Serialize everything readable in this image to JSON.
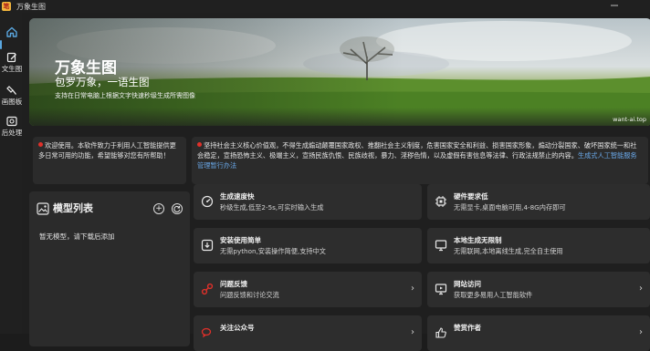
{
  "window": {
    "title": "万象生图",
    "app_icon_glyph": "笔"
  },
  "sidebar": {
    "items": [
      {
        "label": "",
        "icon": "home-icon"
      },
      {
        "label": "文生图",
        "icon": "pen-square-icon"
      },
      {
        "label": "画图板",
        "icon": "paint-tool-icon"
      },
      {
        "label": "后处理",
        "icon": "image-edit-icon"
      }
    ]
  },
  "banner": {
    "title": "万象生图",
    "subtitle": "包罗万象，一语生图",
    "description": "支持在日常电脑上根据文字快速秒级生成所需图像",
    "credit": "want-ai.top"
  },
  "notices": {
    "welcome": "欢迎使用。本软件致力于利用人工智能提供更多日常可用的功能，希望能够对您有所帮助！",
    "policy": "坚持社会主义核心价值观，不得生成煽动颠覆国家政权、推翻社会主义制度，危害国家安全和利益、损害国家形象，煽动分裂国家、破坏国家统一和社会稳定，宣扬恐怖主义、极端主义，宣扬民族仇恨、民族歧视，暴力、淫秽色情，以及虚假有害信息等法律、行政法规禁止的内容。",
    "policy_link": "生成式人工智能服务管理暂行办法"
  },
  "models": {
    "title": "模型列表",
    "empty_text": "暂无模型，请下载后添加"
  },
  "features": [
    {
      "title": "生成速度快",
      "desc": "秒级生成,低至2-5s,可实时输入生成",
      "icon": "speed-icon",
      "chevron": false
    },
    {
      "title": "硬件要求低",
      "desc": "无需显卡,桌面电脑可用,4-8G内存即可",
      "icon": "chip-icon",
      "chevron": false
    },
    {
      "title": "安装使用简单",
      "desc": "无需python,安装操作简便,支持中文",
      "icon": "install-icon",
      "chevron": false
    },
    {
      "title": "本地生成无限制",
      "desc": "无需联网,本地离线生成,完全自主使用",
      "icon": "offline-icon",
      "chevron": false
    },
    {
      "title": "问题反馈",
      "desc": "问题反馈和讨论交流",
      "icon": "feedback-icon",
      "chevron": true
    },
    {
      "title": "网站访问",
      "desc": "获取更多易用人工智能软件",
      "icon": "website-icon",
      "chevron": true
    },
    {
      "title": "关注公众号",
      "desc": "",
      "icon": "wechat-icon",
      "chevron": true
    },
    {
      "title": "赞赏作者",
      "desc": "",
      "icon": "like-icon",
      "chevron": true
    }
  ],
  "colors": {
    "accent": "#5aa7e0",
    "alert_red": "#e0302a",
    "link": "#6aa9ea",
    "card_bg": "#2d2d2d",
    "bg": "#1f1f1f"
  }
}
